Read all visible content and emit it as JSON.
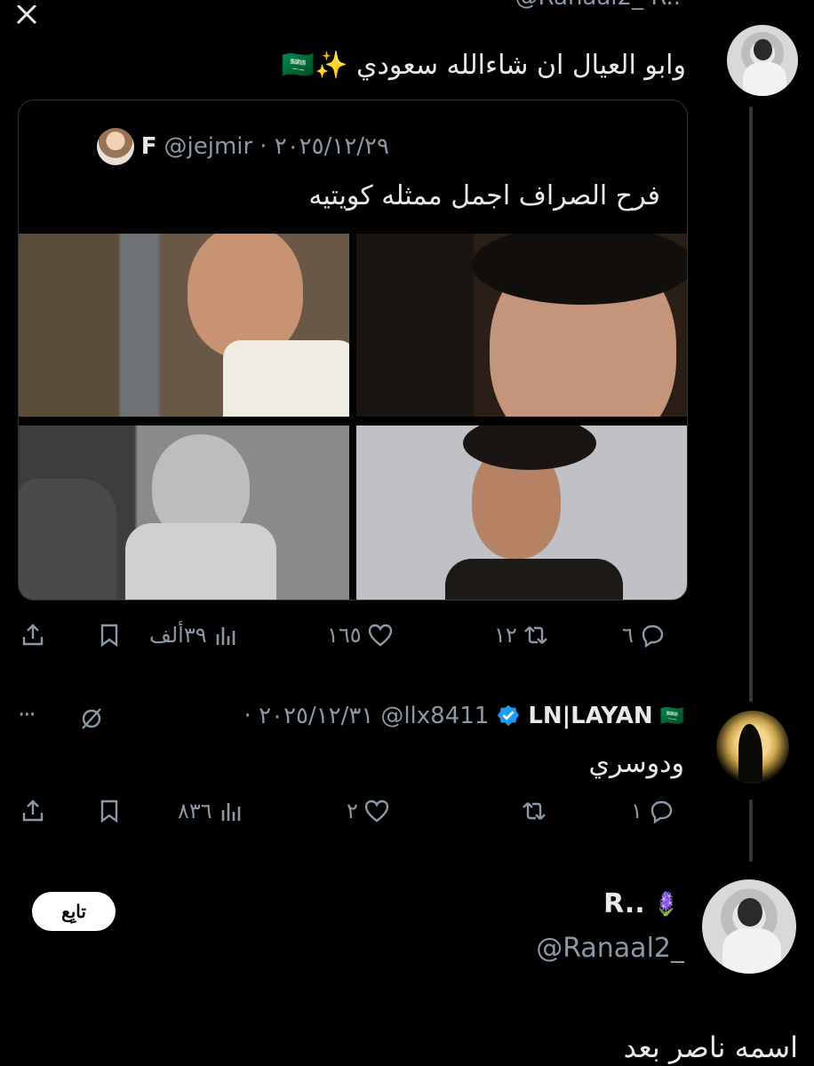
{
  "top_tweet": {
    "partial_header": "@Ranaal2_ R..",
    "text": "وابو العيال ان شاءالله سعودي ✨🇸🇦"
  },
  "quoted_tweet": {
    "name": "F",
    "handle": "@jejmir",
    "date": "· ٢٠٢٥/١٢/٢٩",
    "text": "فرح الصراف اجمل ممثله كويتيه"
  },
  "tweet1_metrics": {
    "replies": "٦",
    "retweets": "١٢",
    "likes": "١٦٥",
    "views": "٣٩ألف"
  },
  "reply_tweet": {
    "name": "LN|LAYAN",
    "flag": "🇸🇦",
    "handle": "@llx8411",
    "date": "· ٢٠٢٥/١٢/٣١",
    "text": "ودوسري",
    "more": "···",
    "metrics": {
      "replies": "١",
      "retweets": "",
      "likes": "٢",
      "views": "٨٣٦"
    }
  },
  "profile_card": {
    "name": "R..",
    "emoji": "🪻",
    "handle": "@Ranaal2_",
    "follow_label": "تابِع"
  },
  "bottom_text": "اسمه ناصر بعد",
  "colors": {
    "background": "#000000",
    "text": "#e7e9ea",
    "muted": "#8b98a5",
    "verified": "#1d9bf0",
    "border": "#2f3336"
  }
}
